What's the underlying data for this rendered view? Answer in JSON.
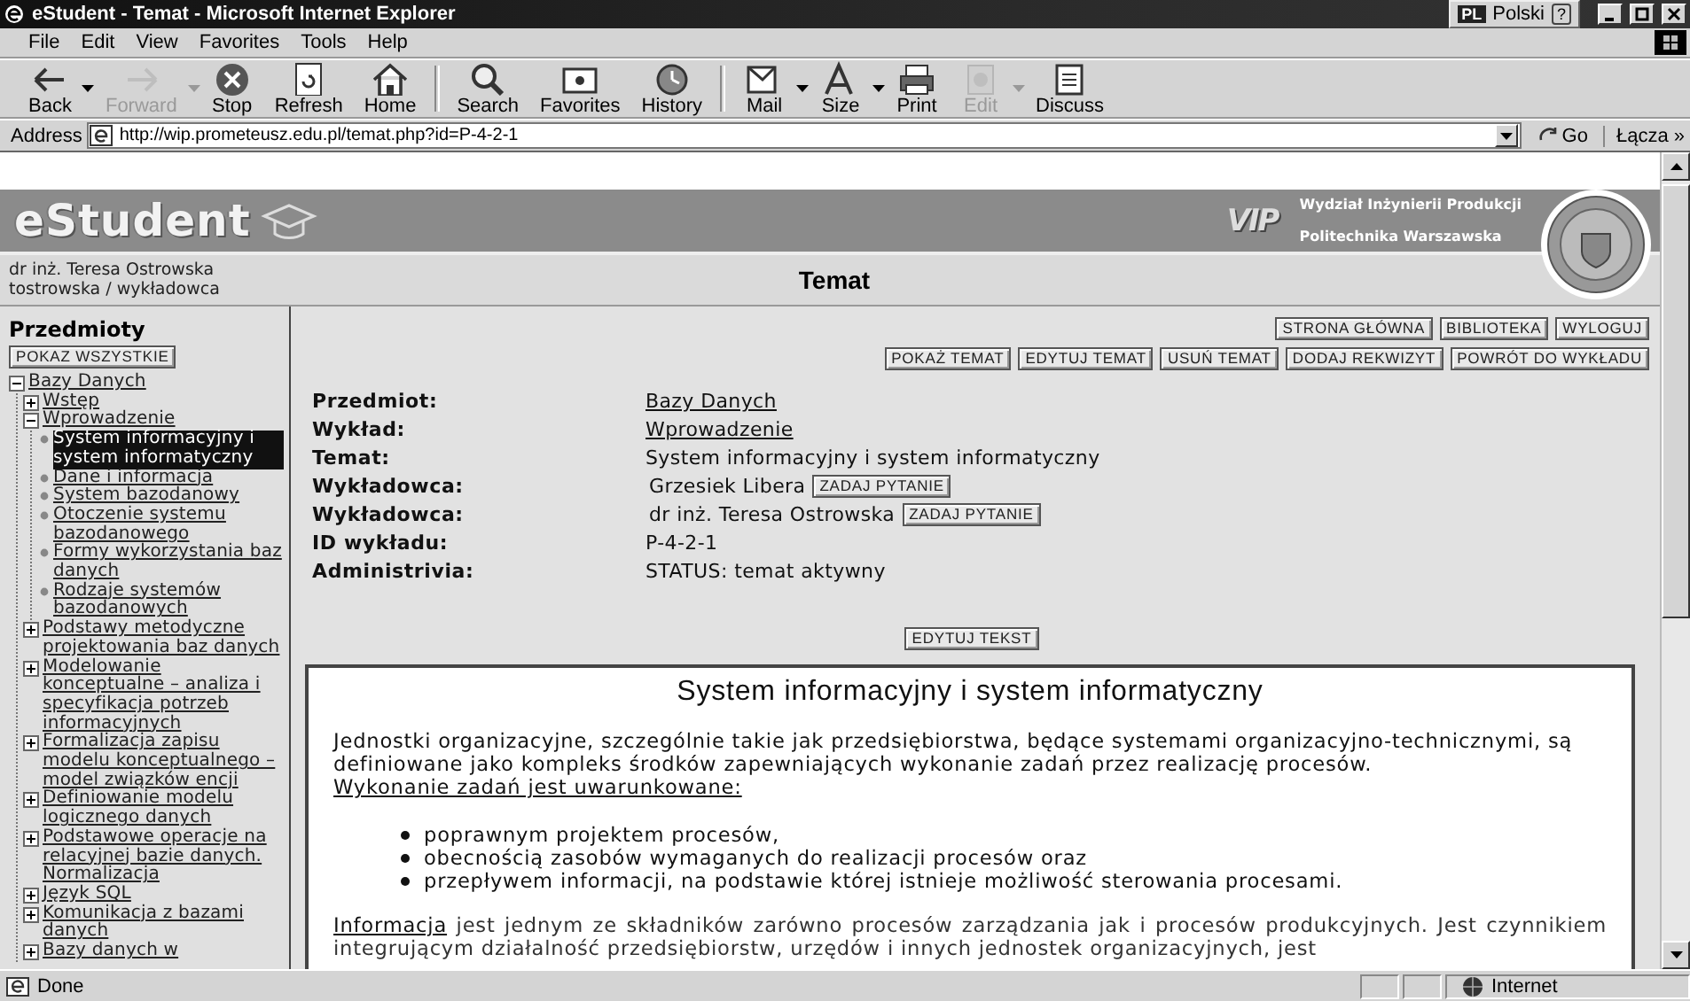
{
  "window": {
    "title": "eStudent - Temat - Microsoft Internet Explorer"
  },
  "language_bar": {
    "code": "PL",
    "name": "Polski",
    "help": "?"
  },
  "menu": [
    "File",
    "Edit",
    "View",
    "Favorites",
    "Tools",
    "Help"
  ],
  "toolbar": [
    {
      "label": "Back",
      "disabled": false,
      "dropdown": true
    },
    {
      "label": "Forward",
      "disabled": true,
      "dropdown": true
    },
    {
      "label": "Stop",
      "disabled": false,
      "dropdown": false
    },
    {
      "label": "Refresh",
      "disabled": false,
      "dropdown": false
    },
    {
      "label": "Home",
      "disabled": false,
      "dropdown": false
    },
    {
      "label": "Search",
      "disabled": false,
      "dropdown": false
    },
    {
      "label": "Favorites",
      "disabled": false,
      "dropdown": false
    },
    {
      "label": "History",
      "disabled": false,
      "dropdown": false
    },
    {
      "label": "Mail",
      "disabled": false,
      "dropdown": true
    },
    {
      "label": "Size",
      "disabled": false,
      "dropdown": true
    },
    {
      "label": "Print",
      "disabled": false,
      "dropdown": false
    },
    {
      "label": "Edit",
      "disabled": true,
      "dropdown": true
    },
    {
      "label": "Discuss",
      "disabled": false,
      "dropdown": false
    }
  ],
  "address": {
    "label": "Address",
    "url": "http://wip.prometeusz.edu.pl/temat.php?id=P-4-2-1",
    "go": "Go",
    "links": "Łącza",
    "links_more": "»"
  },
  "header": {
    "logo": "eStudent",
    "mark": "VIP",
    "faculty": "Wydział Inżynierii Produkcji",
    "university": "Politechnika Warszawska"
  },
  "user": {
    "name": "dr inż. Teresa Ostrowska",
    "login": "tostrowska / wykładowca"
  },
  "page_title": "Temat",
  "sidebar": {
    "title": "Przedmioty",
    "show_all": "POKAZ WSZYSTKIE",
    "tree": [
      {
        "label": "Bazy Danych",
        "kind": "folder",
        "expanded": true,
        "selected": false,
        "children": [
          {
            "label": "Wstęp",
            "kind": "folder",
            "expanded": false,
            "selected": false
          },
          {
            "label": "Wprowadzenie",
            "kind": "folder",
            "expanded": true,
            "selected": false,
            "children": [
              {
                "label": "System informacyjny i system informatyczny",
                "kind": "leaf",
                "selected": true
              },
              {
                "label": "Dane i informacja",
                "kind": "leaf",
                "selected": false
              },
              {
                "label": "System bazodanowy",
                "kind": "leaf",
                "selected": false
              },
              {
                "label": "Otoczenie systemu bazodanowego",
                "kind": "leaf",
                "selected": false
              },
              {
                "label": "Formy wykorzystania baz danych",
                "kind": "leaf",
                "selected": false
              },
              {
                "label": "Rodzaje systemów bazodanowych",
                "kind": "leaf",
                "selected": false
              }
            ]
          },
          {
            "label": "Podstawy metodyczne projektowania baz danych",
            "kind": "folder",
            "expanded": false,
            "selected": false
          },
          {
            "label": "Modelowanie konceptualne – analiza i specyfikacja potrzeb informacyjnych",
            "kind": "folder",
            "expanded": false,
            "selected": false
          },
          {
            "label": "Formalizacja zapisu modelu konceptualnego – model związków encji",
            "kind": "folder",
            "expanded": false,
            "selected": false
          },
          {
            "label": "Definiowanie modelu logicznego danych",
            "kind": "folder",
            "expanded": false,
            "selected": false
          },
          {
            "label": "Podstawowe operacje na relacyjnej bazie danych. Normalizacja",
            "kind": "folder",
            "expanded": false,
            "selected": false
          },
          {
            "label": "Język SQL",
            "kind": "folder",
            "expanded": false,
            "selected": false
          },
          {
            "label": "Komunikacja z bazami danych",
            "kind": "folder",
            "expanded": false,
            "selected": false
          },
          {
            "label": "Bazy danych w",
            "kind": "folder",
            "expanded": false,
            "selected": false
          }
        ]
      }
    ]
  },
  "nav_buttons": [
    "STRONA GŁÓWNA",
    "BIBLIOTEKA",
    "WYLOGUJ"
  ],
  "action_buttons": [
    "POKAŻ TEMAT",
    "EDYTUJ TEMAT",
    "USUŃ TEMAT",
    "DODAJ REKWIZYT",
    "POWRÓT DO WYKŁADU"
  ],
  "details": [
    {
      "label": "Przedmiot:",
      "value": "Bazy Danych",
      "kind": "link"
    },
    {
      "label": "Wykład:",
      "value": "Wprowadzenie",
      "kind": "link"
    },
    {
      "label": "Temat:",
      "value": "System informacyjny i system informatyczny",
      "kind": "text"
    },
    {
      "label": "Wykładowca:",
      "value": "Grzesiek Libera",
      "kind": "lecturer",
      "button": "ZADAJ PYTANIE"
    },
    {
      "label": "Wykładowca:",
      "value": "dr inż. Teresa Ostrowska",
      "kind": "lecturer",
      "button": "ZADAJ PYTANIE"
    },
    {
      "label": "ID wykładu:",
      "value": "P-4-2-1",
      "kind": "text"
    },
    {
      "label": "Administrivia:",
      "value": "STATUS: temat aktywny",
      "kind": "text"
    }
  ],
  "edit_text_button": "EDYTUJ TEKST",
  "article": {
    "title": "System informacyjny i system informatyczny",
    "intro": "Jednostki organizacyjne, szczególnie takie jak przedsiębiorstwa, będące systemami organizacyjno-technicznymi, są definiowane jako kompleks środków zapewniających wykonanie zadań przez realizację procesów.",
    "conditions": "Wykonanie zadań jest uwarunkowane:",
    "bullets": [
      "poprawnym projektem procesów,",
      "obecnością zasobów wymaganych do realizacji procesów oraz",
      "przepływem informacji, na podstawie której istnieje możliwość sterowania procesami."
    ],
    "term": "Informacja",
    "paragraph": "jest jednym ze składników zarówno procesów zarządzania jak i procesów produkcyjnych. Jest czynnikiem integrującym działalność przedsiębiorstw, urzędów i innych jednostek organizacyjnych, jest"
  },
  "status_bar": {
    "text": "Done",
    "zone": "Internet"
  }
}
